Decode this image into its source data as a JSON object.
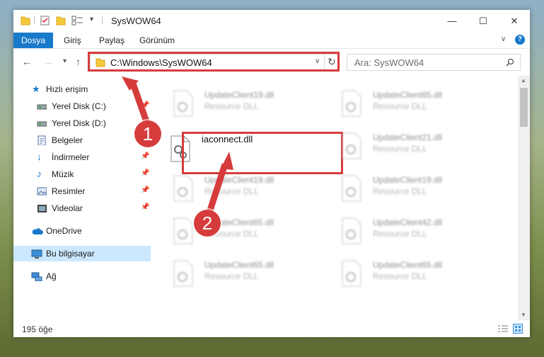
{
  "window": {
    "title": "SysWOW64",
    "controls": {
      "minimize": "—",
      "maximize": "☐",
      "close": "✕"
    }
  },
  "ribbon": {
    "tabs": [
      {
        "label": "Dosya",
        "active": true
      },
      {
        "label": "Giriş",
        "active": false
      },
      {
        "label": "Paylaş",
        "active": false
      },
      {
        "label": "Görünüm",
        "active": false
      }
    ],
    "help": "?"
  },
  "nav": {
    "address": "C:\\Windows\\SysWOW64",
    "search_placeholder": "Ara: SysWOW64"
  },
  "sidebar": {
    "items": [
      {
        "label": "Hızlı erişim",
        "icon": "star-icon",
        "pinned": false
      },
      {
        "label": "Yerel Disk (C:)",
        "icon": "drive-icon",
        "pinned": true
      },
      {
        "label": "Yerel Disk (D:)",
        "icon": "drive-icon",
        "pinned": false
      },
      {
        "label": "Belgeler",
        "icon": "documents-icon",
        "pinned": true
      },
      {
        "label": "İndirmeler",
        "icon": "download-icon",
        "pinned": true
      },
      {
        "label": "Müzik",
        "icon": "music-icon",
        "pinned": true
      },
      {
        "label": "Resimler",
        "icon": "pictures-icon",
        "pinned": true
      },
      {
        "label": "Videolar",
        "icon": "videos-icon",
        "pinned": true
      },
      {
        "label": "OneDrive",
        "icon": "cloud-icon",
        "pinned": false
      },
      {
        "label": "Bu bilgisayar",
        "icon": "computer-icon",
        "pinned": false,
        "selected": true
      },
      {
        "label": "Ağ",
        "icon": "network-icon",
        "pinned": false
      }
    ]
  },
  "files": {
    "focused": {
      "name": "iaconnect.dll"
    },
    "blurred": [
      {
        "name": "UpdateClient19.dll",
        "type": "Resource DLL"
      },
      {
        "name": "UpdateClient65.dll",
        "type": "Resource DLL"
      },
      {
        "name": "UpdateClient21.dll",
        "type": "Resource DLL"
      },
      {
        "name": "UpdateClient19.dll",
        "type": "Resource DLL"
      },
      {
        "name": "UpdateClient19.dll",
        "type": "Resource DLL"
      },
      {
        "name": "UpdateClient65.dll",
        "type": "Resource DLL"
      },
      {
        "name": "UpdateClient42.dll",
        "type": "Resource DLL"
      },
      {
        "name": "UpdateClient65.dll",
        "type": "Resource DLL"
      },
      {
        "name": "UpdateClient65.dll",
        "type": "Resource DLL"
      }
    ]
  },
  "status": {
    "count": "195 öğe"
  },
  "callouts": [
    "1",
    "2"
  ],
  "colors": {
    "accent": "#1979ca",
    "highlight": "#d63c3c",
    "selected": "#cce8ff"
  }
}
